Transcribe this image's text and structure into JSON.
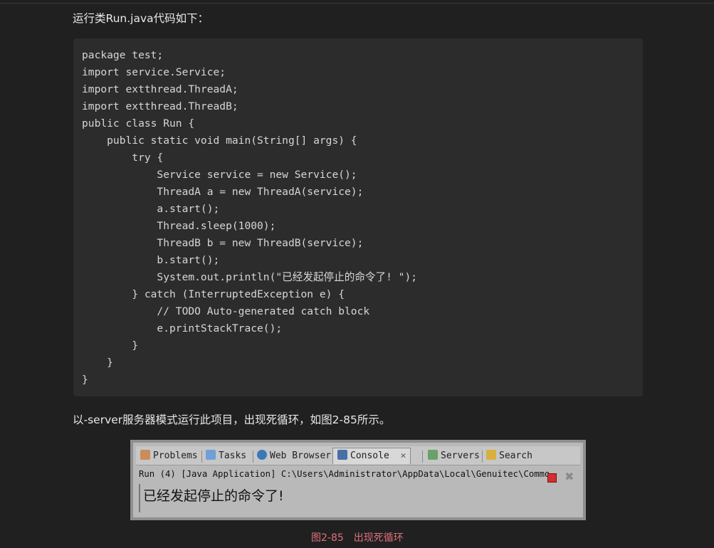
{
  "intro_text": "运行类Run.java代码如下：",
  "code_lines": [
    "package test;",
    "import service.Service;",
    "import extthread.ThreadA;",
    "import extthread.ThreadB;",
    "public class Run {",
    "    public static void main(String[] args) {",
    "        try {",
    "            Service service = new Service();",
    "            ThreadA a = new ThreadA(service);",
    "            a.start();",
    "            Thread.sleep(1000);",
    "            ThreadB b = new ThreadB(service);",
    "            b.start();",
    "            System.out.println(\"已经发起停止的命令了! \");",
    "        } catch (InterruptedException e) {",
    "            // TODO Auto-generated catch block",
    "            e.printStackTrace();",
    "        }",
    "    }",
    "}"
  ],
  "followup_text": "以-server服务器模式运行此项目，出现死循环，如图2-85所示。",
  "console": {
    "tabs": [
      {
        "label": "Problems",
        "icon": "problems-icon"
      },
      {
        "label": "Tasks",
        "icon": "tasks-icon"
      },
      {
        "label": "Web Browser",
        "icon": "globe-icon"
      },
      {
        "label": "Console",
        "icon": "console-icon",
        "active": true
      },
      {
        "label": "Servers",
        "icon": "servers-icon"
      },
      {
        "label": "Search",
        "icon": "search-icon"
      }
    ],
    "path": "Run (4) [Java Application] C:\\Users\\Administrator\\AppData\\Local\\Genuitec\\Commo",
    "output": "已经发起停止的命令了!"
  },
  "figure_caption": "图2-85　出现死循环",
  "colors": {
    "background": "#202021",
    "code_background": "#2c2c2c",
    "caption": "#e0707a"
  }
}
